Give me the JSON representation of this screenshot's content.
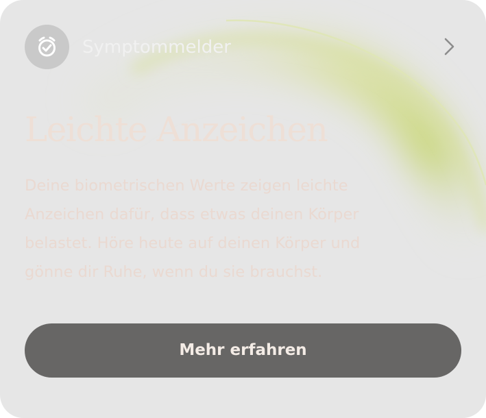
{
  "card": {
    "background": "#e6e6e6",
    "accent_glow": "#c9d77a"
  },
  "header": {
    "icon": "timer-check-icon",
    "title": "Symptommelder",
    "chevron_icon": "chevron-right-icon"
  },
  "content": {
    "headline": "Leichte Anzeichen",
    "lines": [
      "Deine biometrischen Werte zeigen leichte",
      "Anzeichen dafür, dass etwas deinen Körper",
      "belastet. Höre heute auf deinen Körper und",
      "gönne dir Ruhe, wenn du sie brauchst."
    ]
  },
  "cta": {
    "label": "Mehr erfahren",
    "background": "#676665"
  }
}
